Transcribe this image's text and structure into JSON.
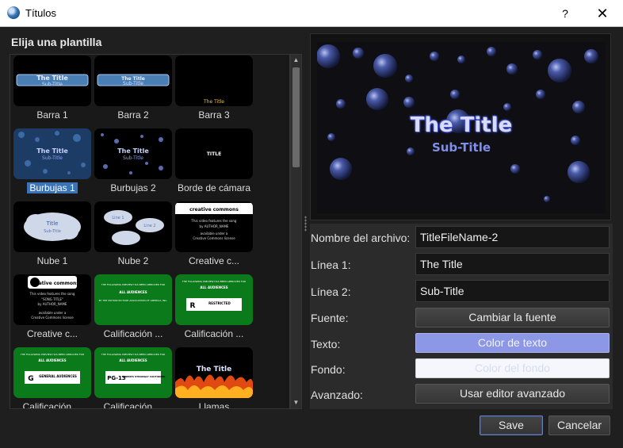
{
  "window": {
    "title": "Títulos",
    "help_label": "?",
    "close_label": "✕"
  },
  "heading": "Elija una plantilla",
  "templates": [
    {
      "label": "Barra 1",
      "selected": false
    },
    {
      "label": "Barra 2",
      "selected": false
    },
    {
      "label": "Barra 3",
      "selected": false
    },
    {
      "label": "Burbujas 1",
      "selected": true
    },
    {
      "label": "Burbujas 2",
      "selected": false
    },
    {
      "label": "Borde de cámara",
      "selected": false
    },
    {
      "label": "Nube 1",
      "selected": false
    },
    {
      "label": "Nube 2",
      "selected": false
    },
    {
      "label": "Creative c...",
      "selected": false
    },
    {
      "label": "Creative c...",
      "selected": false
    },
    {
      "label": "Calificación ...",
      "selected": false
    },
    {
      "label": "Calificación ...",
      "selected": false
    },
    {
      "label": "Calificación ...",
      "selected": false
    },
    {
      "label": "Calificación ...",
      "selected": false
    },
    {
      "label": "Llamas",
      "selected": false
    }
  ],
  "thumbs": {
    "title": "The Title",
    "sub": "Sub-Title",
    "camera_title": "TITLE",
    "cloud_title": "Title",
    "cloud_sub": "Sub-Title",
    "cloud_line": "Line 1",
    "cloud_line2": "Line 2",
    "cc_logo": "creative commons",
    "cc_text1": "This video features the song",
    "cc_song": "\"SONG TITLE\"",
    "cc_by": "by AUTHOR_NAME",
    "cc_avail": "available under a",
    "cc_license": "Creative Commons license",
    "rating_header": "THE FOLLOWING PREVIEW HAS BEEN APPROVED FOR",
    "rating_aud": "ALL AUDIENCES",
    "rating_assoc": "BY THE MOTION PICTURE ASSOCIATION OF AMERICA, INC.",
    "rating_r": "R",
    "rating_r_word": "RESTRICTED",
    "rating_g": "G",
    "rating_g_word": "GENERAL AUDIENCES",
    "rating_pg": "PG-13",
    "rating_pg_word": "PARENTS STRONGLY CAUTIONED"
  },
  "preview": {
    "title": "The Title",
    "subtitle": "Sub-Title"
  },
  "form": {
    "filename_label": "Nombre del archivo:",
    "filename_value": "TitleFileName-2",
    "line1_label": "Línea 1:",
    "line1_value": "The Title",
    "line2_label": "Línea 2:",
    "line2_value": "Sub-Title",
    "font_label": "Fuente:",
    "font_button": "Cambiar la fuente",
    "text_label": "Texto:",
    "text_button": "Color de texto",
    "bg_label": "Fondo:",
    "bg_button": "Color del fondo",
    "advanced_label": "Avanzado:",
    "advanced_button": "Usar editor avanzado"
  },
  "footer": {
    "save": "Save",
    "cancel": "Cancelar"
  },
  "colors": {
    "accent": "#8c97e6",
    "selection": "#3b73b8",
    "rating_green": "#0a7a1a",
    "bubble": "#4a5aa8"
  }
}
